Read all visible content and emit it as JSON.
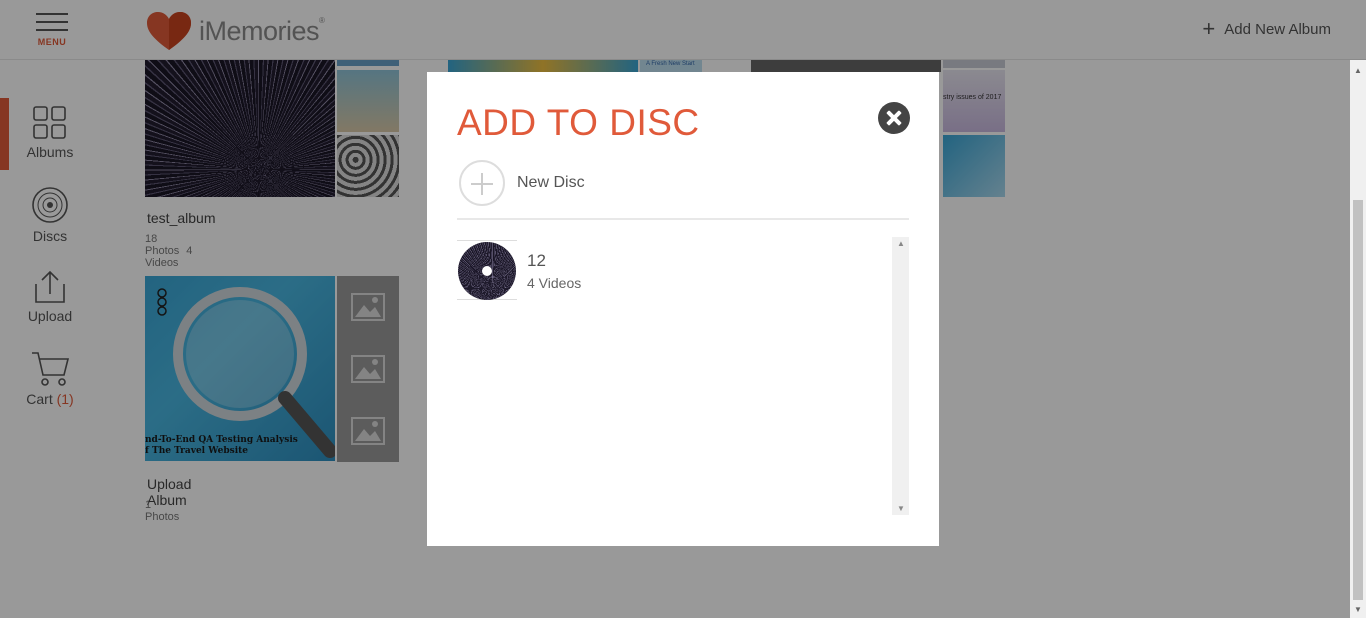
{
  "header": {
    "menu_label": "MENU",
    "logo_text": "iMemories",
    "logo_mark": "®",
    "add_album_label": "Add New Album"
  },
  "sidebar": {
    "items": [
      {
        "label": "Albums",
        "icon": "grid-icon",
        "active": true
      },
      {
        "label": "Discs",
        "icon": "disc-icon",
        "active": false
      },
      {
        "label": "Upload",
        "icon": "upload-icon",
        "active": false
      },
      {
        "label": "Cart",
        "icon": "cart-icon",
        "active": false,
        "count": "(1)"
      }
    ]
  },
  "albums": [
    {
      "title": "test_album",
      "photos": "18 Photos",
      "videos": "4 Videos"
    },
    {
      "title": "Upload Album",
      "photos": "1 Photos"
    }
  ],
  "background_text": {
    "fresh_start": "A Fresh New Start",
    "industry_issues": "stry issues of 2017",
    "qa_caption_line1": "nd-To-End QA Testing Analysis",
    "qa_caption_line2": "f The Travel Website"
  },
  "modal": {
    "title": "ADD TO DISC",
    "new_disc_label": "New Disc",
    "discs": [
      {
        "name": "12",
        "meta": "4 Videos"
      }
    ]
  },
  "colors": {
    "accent": "#e05a3a",
    "overlay": "rgba(0,0,0,0.40)"
  }
}
